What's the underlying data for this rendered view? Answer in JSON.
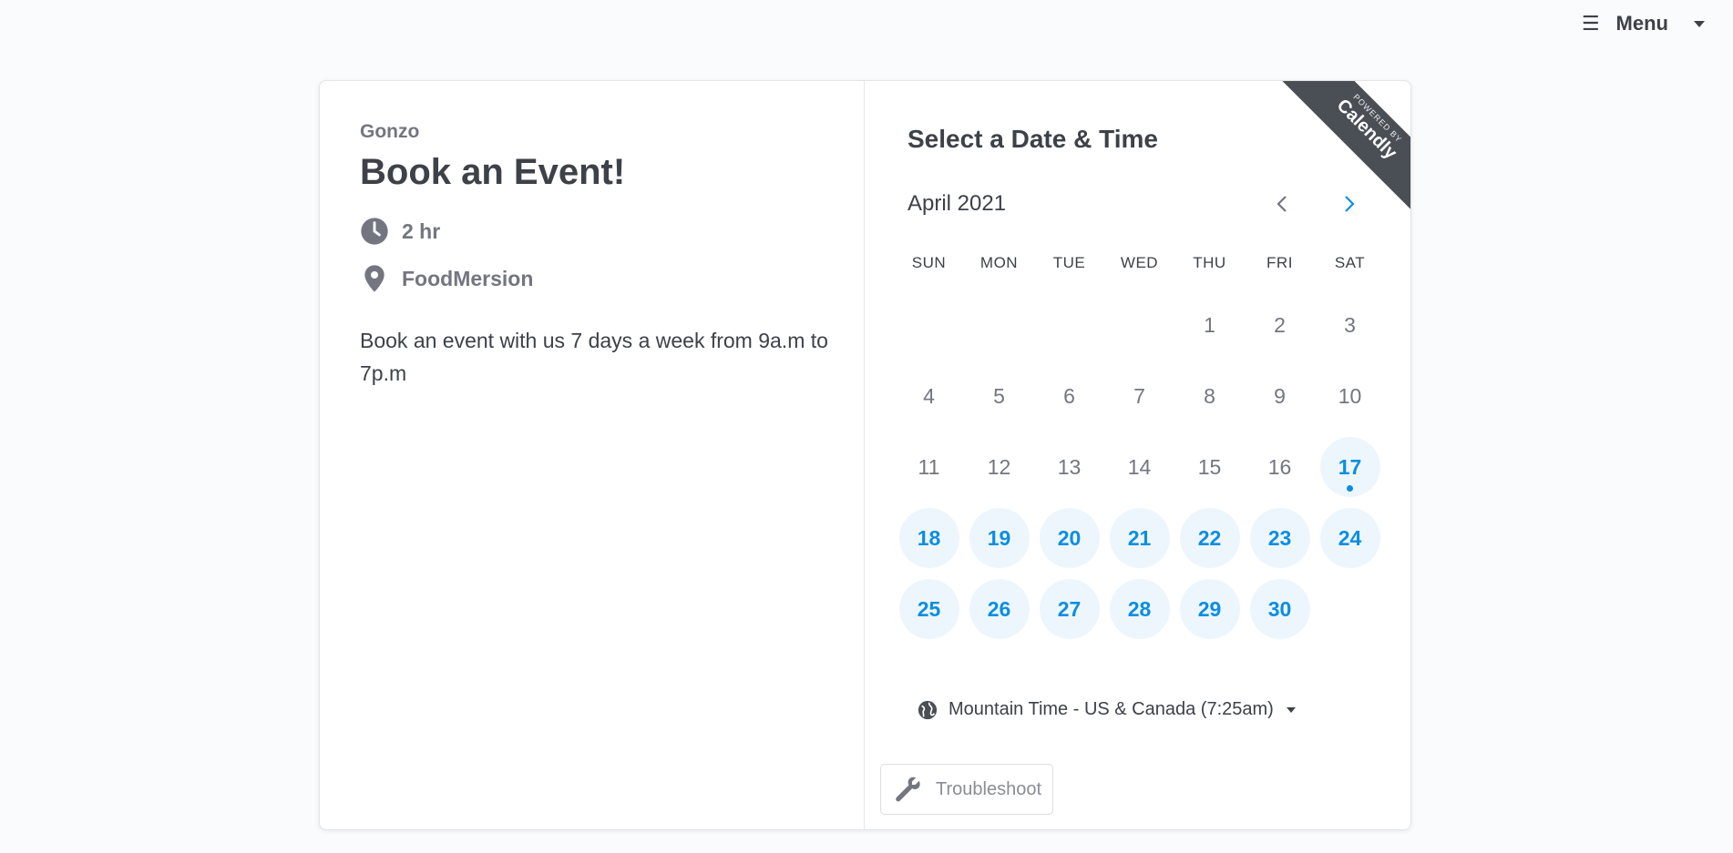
{
  "header": {
    "menu_label": "Menu"
  },
  "event": {
    "organizer": "Gonzo",
    "title": "Book an Event!",
    "duration": "2 hr",
    "location": "FoodMersion",
    "description": "Book an event with us 7 days a week from 9a.m to 7p.m"
  },
  "scheduler": {
    "heading": "Select a Date & Time",
    "month_label": "April 2021",
    "weekdays": [
      "SUN",
      "MON",
      "TUE",
      "WED",
      "THU",
      "FRI",
      "SAT"
    ],
    "days": [
      {
        "label": "",
        "available": false
      },
      {
        "label": "",
        "available": false
      },
      {
        "label": "",
        "available": false
      },
      {
        "label": "",
        "available": false
      },
      {
        "label": "1",
        "available": false
      },
      {
        "label": "2",
        "available": false
      },
      {
        "label": "3",
        "available": false
      },
      {
        "label": "4",
        "available": false
      },
      {
        "label": "5",
        "available": false
      },
      {
        "label": "6",
        "available": false
      },
      {
        "label": "7",
        "available": false
      },
      {
        "label": "8",
        "available": false
      },
      {
        "label": "9",
        "available": false
      },
      {
        "label": "10",
        "available": false
      },
      {
        "label": "11",
        "available": false
      },
      {
        "label": "12",
        "available": false
      },
      {
        "label": "13",
        "available": false
      },
      {
        "label": "14",
        "available": false
      },
      {
        "label": "15",
        "available": false
      },
      {
        "label": "16",
        "available": false
      },
      {
        "label": "17",
        "available": true,
        "today": true
      },
      {
        "label": "18",
        "available": true
      },
      {
        "label": "19",
        "available": true
      },
      {
        "label": "20",
        "available": true
      },
      {
        "label": "21",
        "available": true
      },
      {
        "label": "22",
        "available": true
      },
      {
        "label": "23",
        "available": true
      },
      {
        "label": "24",
        "available": true
      },
      {
        "label": "25",
        "available": true
      },
      {
        "label": "26",
        "available": true
      },
      {
        "label": "27",
        "available": true
      },
      {
        "label": "28",
        "available": true
      },
      {
        "label": "29",
        "available": true
      },
      {
        "label": "30",
        "available": true
      }
    ],
    "timezone_label": "Mountain Time - US & Canada (7:25am)",
    "troubleshoot_label": "Troubleshoot"
  },
  "ribbon": {
    "small_text": "POWERED BY",
    "brand_text": "Calendly"
  },
  "colors": {
    "accent": "#0b8ee2",
    "accent_bg": "#eef6fd",
    "ribbon": "#4a4f55"
  }
}
